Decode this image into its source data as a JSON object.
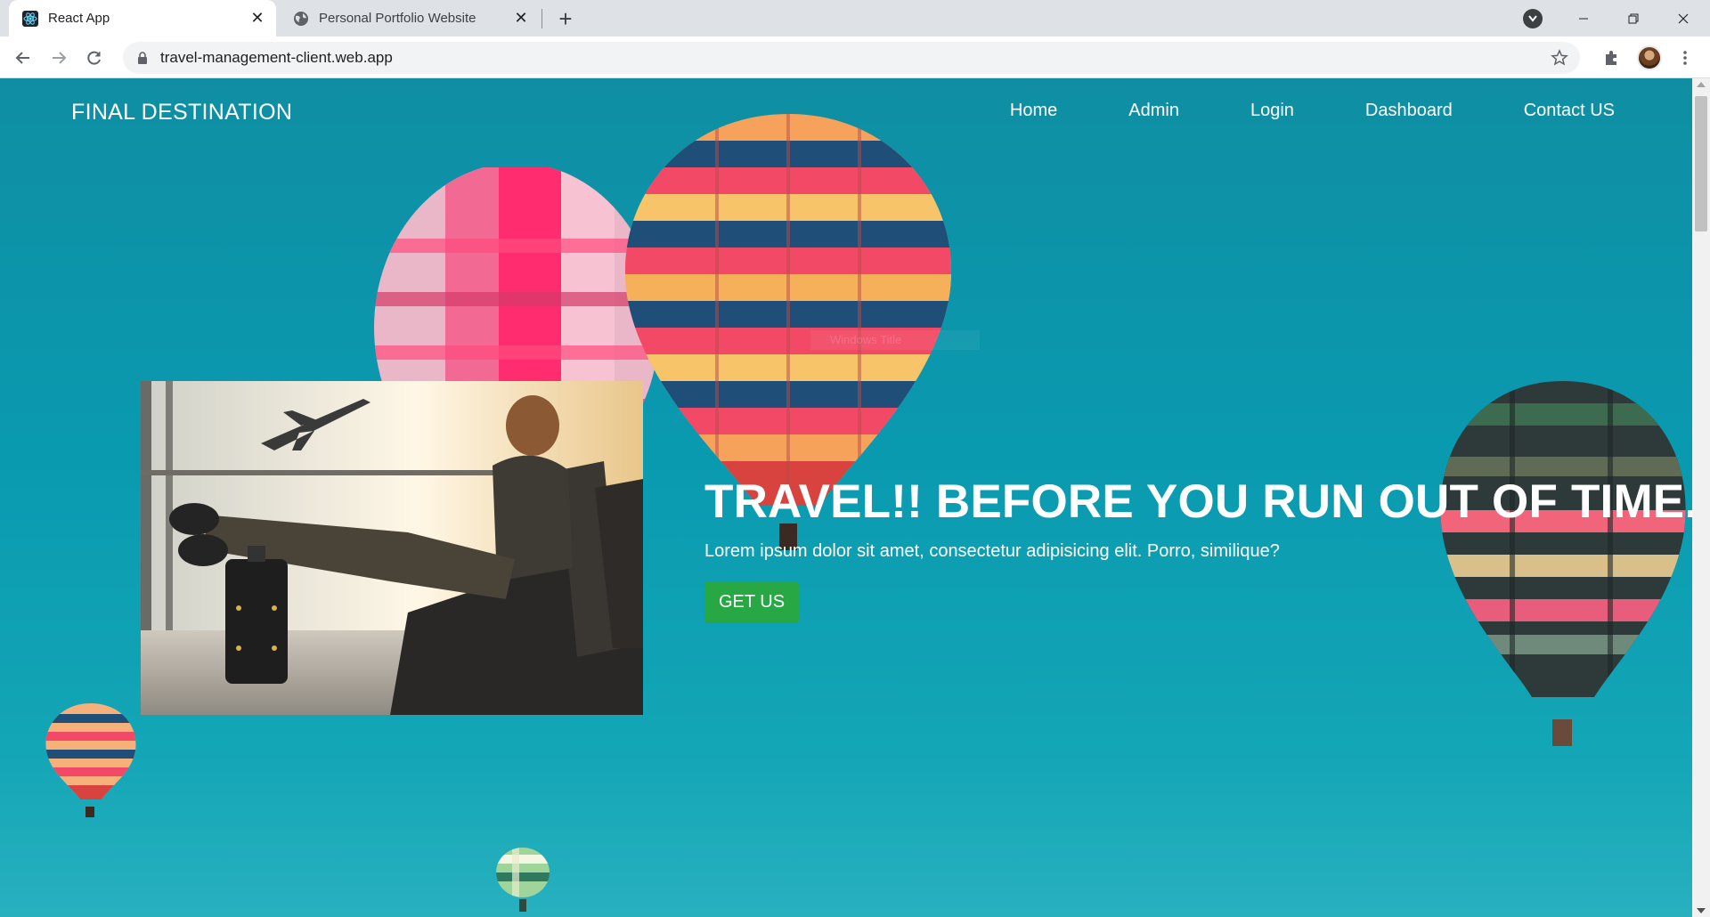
{
  "browser": {
    "tabs": [
      {
        "title": "React App",
        "active": true,
        "favicon": "react-icon"
      },
      {
        "title": "Personal Portfolio Website",
        "active": false,
        "favicon": "globe-icon"
      }
    ],
    "url": "travel-management-client.web.app"
  },
  "site": {
    "brand": "FINAL DESTINATION",
    "nav": [
      "Home",
      "Admin",
      "Login",
      "Dashboard",
      "Contact US"
    ],
    "hero": {
      "title": "TRAVEL!! BEFORE YOU RUN OUT OF TIME.",
      "subtitle": "Lorem ipsum dolor sit amet, consectetur adipisicing elit. Porro, similique?",
      "cta": "GET US"
    },
    "watermark": "Windows Title"
  },
  "colors": {
    "background": "#0a9ab0",
    "cta": "#28a745",
    "text": "#ffffff"
  }
}
